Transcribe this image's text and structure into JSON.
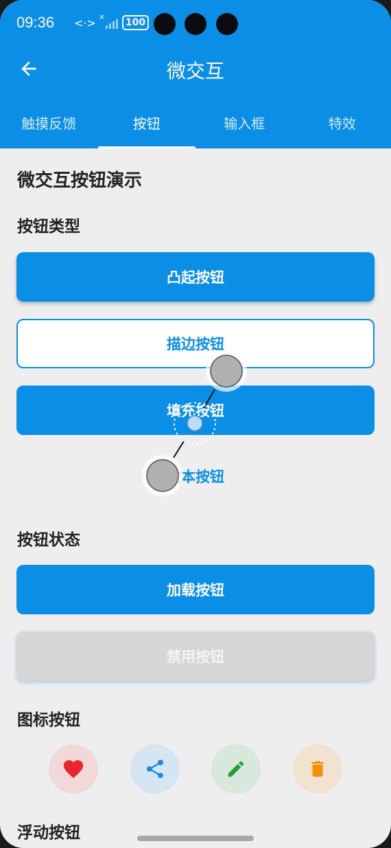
{
  "status_bar": {
    "time": "09:36",
    "network": "<·>",
    "signal_x": "×",
    "battery": "100"
  },
  "app_bar": {
    "title": "微交互"
  },
  "tabs": [
    {
      "label": "触摸反馈",
      "active": false
    },
    {
      "label": "按钮",
      "active": true
    },
    {
      "label": "输入框",
      "active": false
    },
    {
      "label": "特效",
      "active": false
    }
  ],
  "page": {
    "heading": "微交互按钮演示",
    "section_types": "按钮类型",
    "raised_label": "凸起按钮",
    "outlined_label": "描边按钮",
    "filled_label": "填充按钮",
    "text_label": "文本按钮",
    "section_states": "按钮状态",
    "loading_label": "加载按钮",
    "disabled_label": "禁用按钮",
    "section_icons": "图标按钮",
    "section_fab": "浮动按钮"
  },
  "icon_buttons": [
    {
      "icon": "heart-icon",
      "color": "#e8262c",
      "bg": "#f1d9da"
    },
    {
      "icon": "share-icon",
      "color": "#1e88e5",
      "bg": "#d5e5f2"
    },
    {
      "icon": "edit-icon",
      "color": "#1fa03c",
      "bg": "#d8e8dc"
    },
    {
      "icon": "delete-icon",
      "color": "#f2900a",
      "bg": "#f2e3d0"
    }
  ],
  "colors": {
    "primary": "#0a8ee6",
    "background": "#eeeeee"
  }
}
